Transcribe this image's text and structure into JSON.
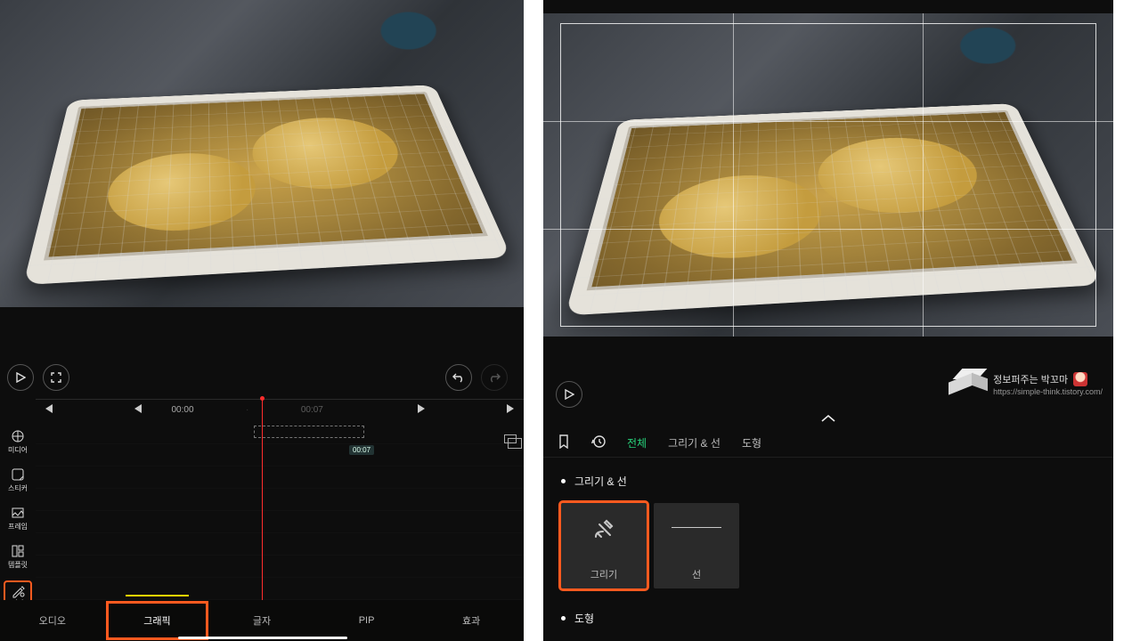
{
  "left": {
    "controls": {
      "play_icon": "play-icon",
      "expand_icon": "expand-icon",
      "undo_icon": "undo-icon",
      "redo_icon": "redo-icon"
    },
    "ruler": {
      "prev_clip_icon": "skip-start-icon",
      "prev_frame_icon": "prev-frame-icon",
      "t0": "00:00",
      "t1": "00:07",
      "next_frame_icon": "next-frame-icon",
      "next_clip_icon": "skip-end-icon"
    },
    "clip_duration": "00:07",
    "side_tools": [
      {
        "name": "media",
        "label": "미디어"
      },
      {
        "name": "sticker",
        "label": "스티커"
      },
      {
        "name": "frame",
        "label": "프레임"
      },
      {
        "name": "template",
        "label": "템플릿"
      },
      {
        "name": "draw",
        "label": "그리기 & 도형",
        "highlight": true
      }
    ],
    "bottom_tabs": [
      {
        "name": "audio",
        "label": "오디오"
      },
      {
        "name": "graphic",
        "label": "그래픽",
        "active": true,
        "highlight": true
      },
      {
        "name": "text",
        "label": "글자"
      },
      {
        "name": "pip",
        "label": "PIP"
      },
      {
        "name": "effect",
        "label": "효과"
      }
    ]
  },
  "right": {
    "credit": {
      "title": "정보퍼주는 박꼬마",
      "url": "https://simple-think.tistory.com/"
    },
    "filters": {
      "bookmark_icon": "bookmark-icon",
      "history_icon": "history-icon",
      "items": [
        {
          "name": "all",
          "label": "전체",
          "active": true
        },
        {
          "name": "drawline",
          "label": "그리기 & 선"
        },
        {
          "name": "shape",
          "label": "도형"
        }
      ]
    },
    "section_drawline": {
      "title": "그리기 & 선",
      "cards": [
        {
          "name": "draw",
          "label": "그리기",
          "glyph": "pencil",
          "highlight": true
        },
        {
          "name": "line",
          "label": "선",
          "glyph": "line"
        }
      ]
    },
    "section_shape": {
      "title": "도형"
    }
  }
}
